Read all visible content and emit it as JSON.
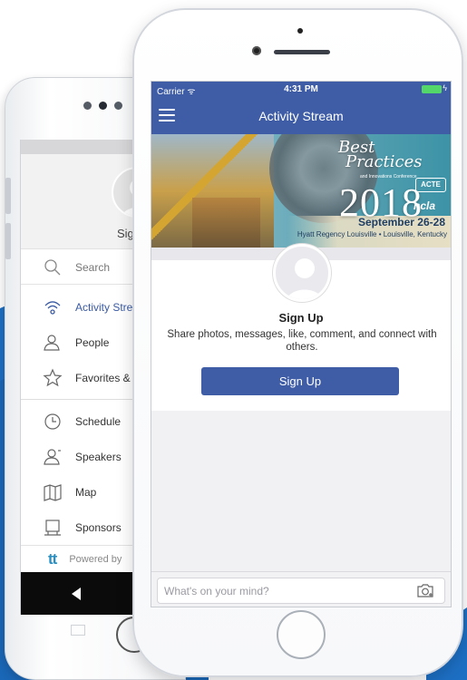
{
  "colors": {
    "accent": "#3e5da6",
    "backdrop_blue": "#1d6fc4",
    "battery": "#53d769"
  },
  "back_phone": {
    "profile": {
      "signup_label": "Sign",
      "avatar_icon": "user-silhouette-icon"
    },
    "menu": {
      "search": {
        "icon": "search-icon",
        "label": "Search"
      },
      "items": [
        {
          "icon": "wifi-stream-icon",
          "label": "Activity Stre",
          "active": true
        },
        {
          "icon": "people-icon",
          "label": "People"
        },
        {
          "icon": "star-icon",
          "label": "Favorites & N"
        },
        {
          "icon": "clock-icon",
          "label": "Schedule"
        },
        {
          "icon": "speaker-icon",
          "label": "Speakers"
        },
        {
          "icon": "map-icon",
          "label": "Map"
        },
        {
          "icon": "sponsor-icon",
          "label": "Sponsors"
        }
      ]
    },
    "footer": {
      "logo": "tt",
      "text": "Powered by"
    },
    "navbar": {
      "back_icon": "triangle-back-icon"
    }
  },
  "front_phone": {
    "statusbar": {
      "carrier": "Carrier ᯤ",
      "time": "4:31 PM",
      "battery_icon": "battery-icon"
    },
    "navbar": {
      "title": "Activity Stream",
      "menu_icon": "hamburger-menu-icon"
    },
    "banner": {
      "script_line1": "Best",
      "script_line2": "Practices",
      "conference": "and Innovations Conference",
      "year": "2018",
      "badge_acte": "ACTE",
      "badge_ncla": "ncla",
      "dates": "September 26-28",
      "venue": "Hyatt Regency Louisville • Louisville, Kentucky"
    },
    "signup": {
      "heading": "Sign Up",
      "description": "Share photos, messages, like, comment, and connect with others.",
      "button_label": "Sign Up"
    },
    "composer": {
      "placeholder": "What's on your mind?",
      "value": "",
      "camera_icon": "camera-plus-icon"
    }
  }
}
